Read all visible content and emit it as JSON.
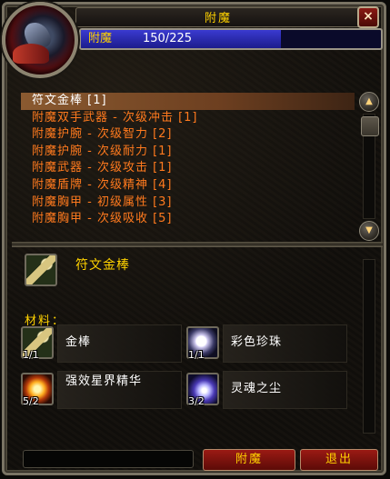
{
  "window": {
    "title": "附魔",
    "close_label": "×"
  },
  "skill": {
    "name": "附魔",
    "value": "150/225",
    "current": 150,
    "max": 225,
    "bar_color": "#2a2ab0"
  },
  "recipes": [
    {
      "label": "符文金棒 [1]",
      "selected": true,
      "color": "#ffffff"
    },
    {
      "label": "附魔双手武器 - 次级冲击 [1]",
      "selected": false,
      "color": "#ff7a1e"
    },
    {
      "label": "附魔护腕 - 次级智力 [2]",
      "selected": false,
      "color": "#ff7a1e"
    },
    {
      "label": "附魔护腕 - 次级耐力 [1]",
      "selected": false,
      "color": "#ff7a1e"
    },
    {
      "label": "附魔武器 - 次级攻击 [1]",
      "selected": false,
      "color": "#ff7a1e"
    },
    {
      "label": "附魔盾牌 - 次级精神 [4]",
      "selected": false,
      "color": "#ff7a1e"
    },
    {
      "label": "附魔胸甲 - 初级属性 [3]",
      "selected": false,
      "color": "#ff7a1e"
    },
    {
      "label": "附魔胸甲 - 次级吸收 [5]",
      "selected": false,
      "color": "#ff7a1e"
    }
  ],
  "detail": {
    "product_name": "符文金棒",
    "product_icon": "golden-rod-icon",
    "materials_label": "材料：",
    "reagents": [
      {
        "name": "金棒",
        "count": "1/1",
        "icon": "golden-rod-icon"
      },
      {
        "name": "彩色珍珠",
        "count": "1/1",
        "icon": "iridescent-pearl-icon"
      },
      {
        "name": "强效星界精华",
        "count": "5/2",
        "icon": "greater-astral-essence-icon"
      },
      {
        "name": "灵魂之尘",
        "count": "3/2",
        "icon": "soul-dust-icon"
      }
    ]
  },
  "buttons": {
    "create_label": "附魔",
    "exit_label": "退出"
  },
  "colors": {
    "title_yellow": "#ffd200",
    "recipe_orange": "#ff7a1e",
    "button_red": "#8a1510"
  }
}
